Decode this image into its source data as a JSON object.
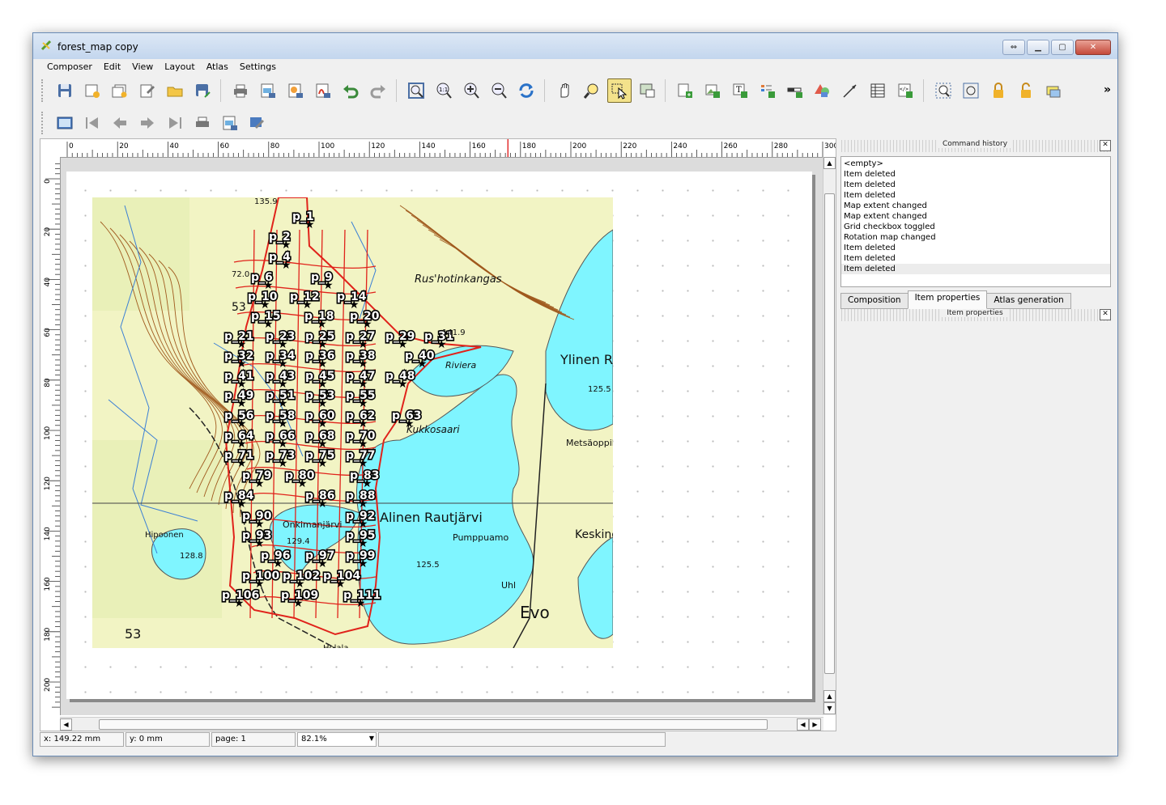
{
  "window": {
    "title": "forest_map copy"
  },
  "menu": [
    "Composer",
    "Edit",
    "View",
    "Layout",
    "Atlas",
    "Settings"
  ],
  "toolbar1": {
    "group_file": [
      "save-icon",
      "new-composer-icon",
      "duplicate-composer-icon",
      "composer-manager-icon",
      "open-template-icon",
      "save-template-icon"
    ],
    "group_print": [
      "print-icon",
      "export-image-icon",
      "export-svg-icon",
      "export-pdf-icon",
      "undo-icon",
      "redo-icon"
    ],
    "group_view": [
      "zoom-full-icon",
      "zoom-actual-icon",
      "zoom-in-icon",
      "zoom-out-icon",
      "refresh-icon"
    ],
    "group_tools": [
      "pan-icon",
      "zoom-tool-icon",
      "select-move-icon",
      "move-content-icon",
      "add-map-icon",
      "add-image-icon",
      "add-label-icon",
      "add-legend-icon",
      "add-scalebar-icon",
      "add-shape-icon",
      "add-arrow-icon",
      "add-table-icon",
      "add-html-icon",
      "group-icon",
      "ungroup-icon",
      "lock-icon",
      "unlock-icon",
      "raise-icon"
    ],
    "overflow": "»"
  },
  "toolbar2": [
    "atlas-preview-icon",
    "first-feature-icon",
    "previous-feature-icon",
    "next-feature-icon",
    "last-feature-icon",
    "print-atlas-icon",
    "export-atlas-icon",
    "atlas-settings-icon"
  ],
  "ruler": {
    "h_labels": [
      "0",
      "20",
      "40",
      "60",
      "80",
      "100",
      "120",
      "140",
      "160",
      "180",
      "200",
      "220",
      "240",
      "260",
      "280",
      "300"
    ],
    "v_labels": [
      "0",
      "20",
      "40",
      "60",
      "80",
      "100",
      "120",
      "140",
      "160",
      "180",
      "200"
    ]
  },
  "status": {
    "x": "x: 149.22 mm",
    "y": "y: 0 mm",
    "page": "page: 1",
    "zoom": "82.1%"
  },
  "panel": {
    "history_title": "Command history",
    "history": [
      "<empty>",
      "Item deleted",
      "Item deleted",
      "Item deleted",
      "Map extent changed",
      "Map extent changed",
      "Grid checkbox toggled",
      "Rotation map changed",
      "Item deleted",
      "Item deleted",
      "Item deleted"
    ],
    "tabs": [
      "Composition",
      "Item properties",
      "Atlas generation"
    ],
    "active_tab": "Item properties",
    "properties_title": "Item properties"
  },
  "map": {
    "place_labels": [
      "Rus'hotinkangas",
      "Ylinen R",
      "Riviera",
      "Kukkosaari",
      "Metsäoppil",
      "Alinen Rautjärvi",
      "Pumppuamo",
      "Keskine",
      "Onkimanjärvi",
      "Evo",
      "Hipoonen",
      "Uhl",
      "Holala"
    ],
    "numbers": [
      "135.9",
      "72.0",
      "53",
      "125.5",
      "129.4",
      "128.8",
      "125.5",
      "53",
      "141.9"
    ],
    "plots": [
      "p_1",
      "p_2",
      "p_4",
      "p_6",
      "p_9",
      "p_10",
      "p_12",
      "p_14",
      "p_15",
      "p_18",
      "p_20",
      "p_21",
      "p_23",
      "p_25",
      "p_27",
      "p_29",
      "p_31",
      "p_32",
      "p_34",
      "p_36",
      "p_38",
      "p_40",
      "p_41",
      "p_43",
      "p_45",
      "p_47",
      "p_48",
      "p_49",
      "p_51",
      "p_53",
      "p_55",
      "p_56",
      "p_58",
      "p_60",
      "p_62",
      "p_63",
      "p_64",
      "p_66",
      "p_68",
      "p_70",
      "p_71",
      "p_73",
      "p_75",
      "p_77",
      "p_79",
      "p_80",
      "p_83",
      "p_84",
      "p_86",
      "p_88",
      "p_90",
      "p_92",
      "p_93",
      "p_95",
      "p_96",
      "p_97",
      "p_99",
      "p_100",
      "p_102",
      "p_104",
      "p_106",
      "p_109",
      "p_111"
    ],
    "colors": {
      "land": "#f2f4c4",
      "water": "#7ff5ff",
      "boundary": "#e0231b",
      "contour": "#a05a1e",
      "stream": "#3a7fd5"
    }
  }
}
